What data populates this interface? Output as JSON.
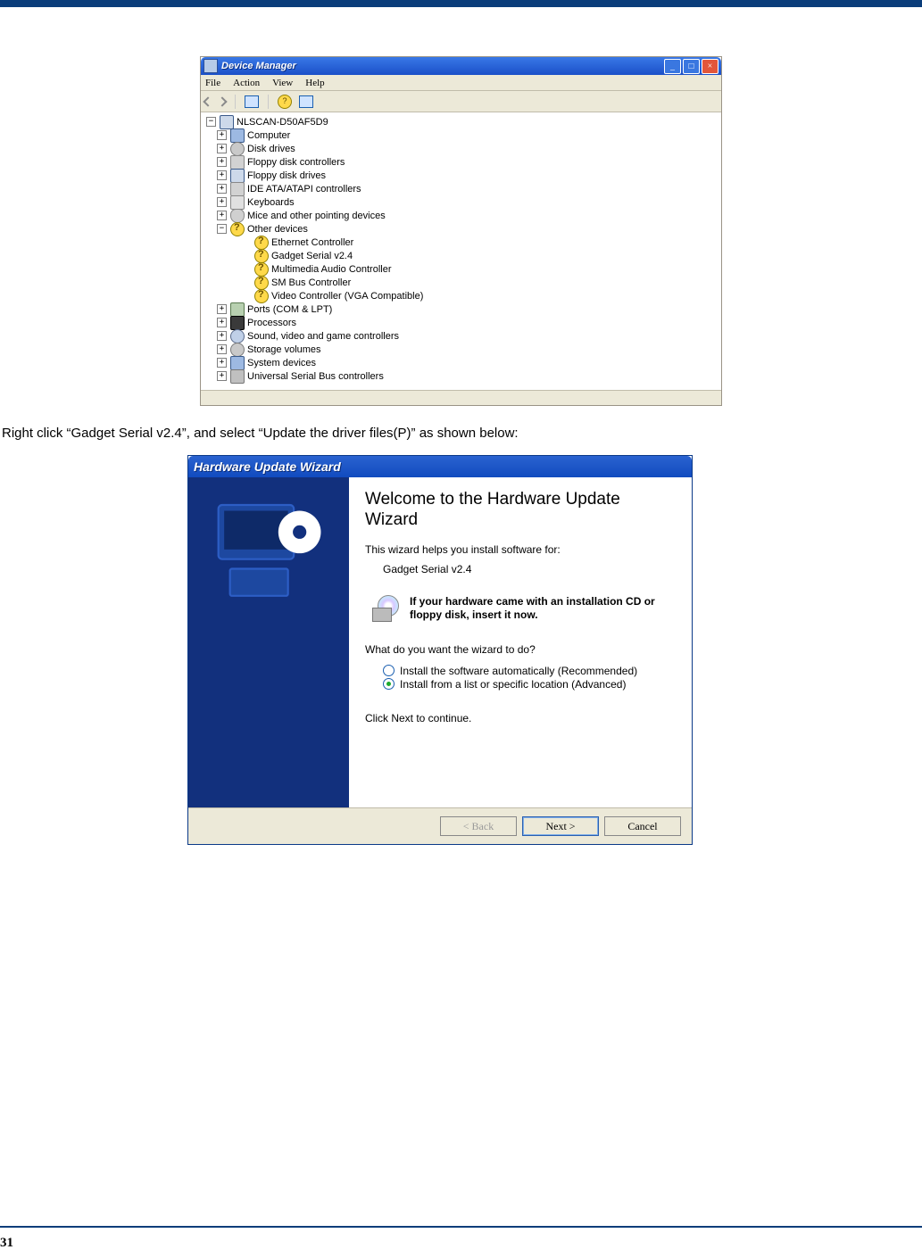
{
  "page_number": "31",
  "instruction": "Right click “Gadget Serial v2.4”, and select “Update the driver files(P)” as shown below:",
  "device_manager": {
    "title": "Device Manager",
    "menu": [
      "File",
      "Action",
      "View",
      "Help"
    ],
    "root": "NLSCAN-D50AF5D9",
    "categories": [
      {
        "label": "Computer",
        "icon": "ico-comp",
        "exp": "+"
      },
      {
        "label": "Disk drives",
        "icon": "ico-disk",
        "exp": "+"
      },
      {
        "label": "Floppy disk controllers",
        "icon": "ico-flop",
        "exp": "+"
      },
      {
        "label": "Floppy disk drives",
        "icon": "ico-pc",
        "exp": "+"
      },
      {
        "label": "IDE ATA/ATAPI controllers",
        "icon": "ico-flop",
        "exp": "+"
      },
      {
        "label": "Keyboards",
        "icon": "ico-kb",
        "exp": "+"
      },
      {
        "label": "Mice and other pointing devices",
        "icon": "ico-mouse",
        "exp": "+"
      },
      {
        "label": "Other devices",
        "icon": "ico-q",
        "exp": "−"
      },
      {
        "label": "Ports (COM & LPT)",
        "icon": "ico-port",
        "exp": "+"
      },
      {
        "label": "Processors",
        "icon": "ico-chip",
        "exp": "+"
      },
      {
        "label": "Sound, video and game controllers",
        "icon": "ico-snd",
        "exp": "+"
      },
      {
        "label": "Storage volumes",
        "icon": "ico-disk",
        "exp": "+"
      },
      {
        "label": "System devices",
        "icon": "ico-comp",
        "exp": "+"
      },
      {
        "label": "Universal Serial Bus controllers",
        "icon": "ico-usb",
        "exp": "+"
      }
    ],
    "other_devices": [
      "Ethernet Controller",
      "Gadget Serial v2.4",
      "Multimedia Audio Controller",
      "SM Bus Controller",
      "Video Controller (VGA Compatible)"
    ]
  },
  "wizard": {
    "title": "Hardware Update Wizard",
    "heading": "Welcome to the Hardware Update Wizard",
    "intro": "This wizard helps you install software for:",
    "device": "Gadget Serial v2.4",
    "cd_text": "If your hardware came with an installation CD or floppy disk, insert it now.",
    "question": "What do you want the wizard to do?",
    "option_auto": "Install the software automatically (Recommended)",
    "option_list": "Install from a list or specific location (Advanced)",
    "click_next": "Click Next to continue.",
    "btn_back": "< Back",
    "btn_next": "Next >",
    "btn_cancel": "Cancel"
  }
}
